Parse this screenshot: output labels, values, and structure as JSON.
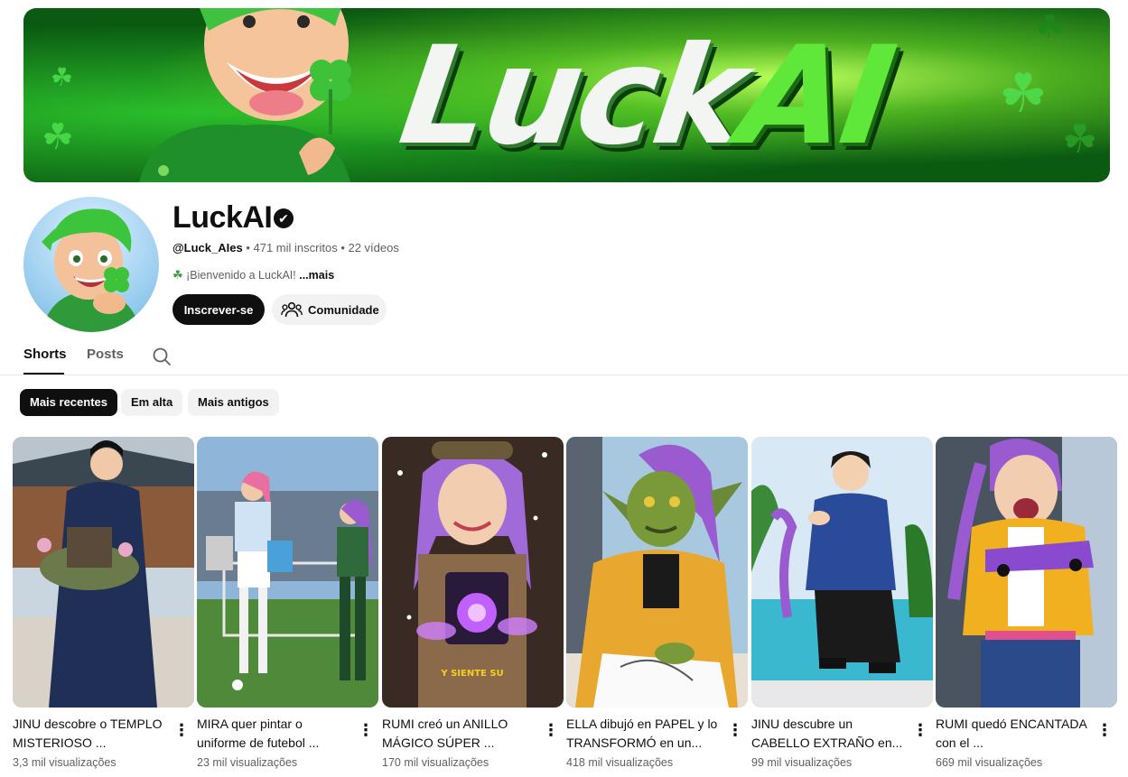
{
  "banner": {
    "title_part1": "Luck",
    "title_part2": "AI"
  },
  "channel": {
    "name": "LuckAI",
    "verified_mark": "✔",
    "handle": "@Luck_AIes",
    "subscribers": "471 mil inscritos",
    "videos": "22 vídeos",
    "separator": " • ",
    "description": "¡Bienvenido a LuckAI!",
    "more_label": "...mais",
    "subscribe_label": "Inscrever-se",
    "community_label": "Comunidade"
  },
  "tabs": [
    {
      "label": "Shorts",
      "active": true
    },
    {
      "label": "Posts",
      "active": false
    }
  ],
  "chips": [
    {
      "label": "Mais recentes",
      "active": true
    },
    {
      "label": "Em alta",
      "active": false
    },
    {
      "label": "Mais antigos",
      "active": false
    }
  ],
  "shorts": [
    {
      "title": "JINU descobre o TEMPLO MISTERIOSO ...",
      "views": "3,3 mil visualizações"
    },
    {
      "title": "MIRA quer pintar o uniforme de futebol ...",
      "views": "23 mil visualizações"
    },
    {
      "title": "RUMI creó un ANILLO MÁGICO SÚPER ...",
      "views": "170 mil visualizações",
      "caption": "Y SIENTE SU"
    },
    {
      "title": "ELLA dibujó en PAPEL y lo TRANSFORMÓ en un...",
      "views": "418 mil visualizações"
    },
    {
      "title": "JINU descubre un CABELLO EXTRAÑO en...",
      "views": "99 mil visualizações"
    },
    {
      "title": "RUMI quedó ENCANTADA con el ...",
      "views": "669 mil visualizações"
    }
  ],
  "icons": {
    "verified": "verified-check-icon",
    "community": "people-icon",
    "search": "search-icon",
    "more": "kebab-menu-icon",
    "description": "clover-icon"
  },
  "colors": {
    "accent_green": "#5fe83a",
    "button_dark": "#0f0f0f",
    "chip_bg": "#f2f2f2",
    "secondary_text": "#606060"
  }
}
